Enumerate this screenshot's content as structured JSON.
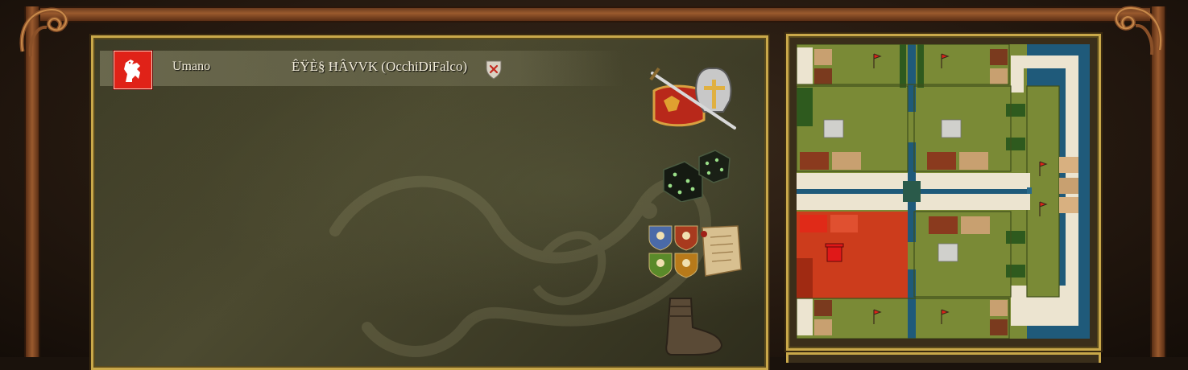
{
  "lobby": {
    "players": [
      {
        "type_label": "Umano",
        "name": "ÊŸÈ§ ĦÂVVK (OcchiDiFalco)",
        "color": "#e02218"
      }
    ]
  },
  "icons": {
    "player_crest": "lion-rampant-icon",
    "kick": "kick-shield-icon",
    "weapons": "sword-helmet-icon",
    "dice": "dice-icon",
    "teams": "team-shields-icon",
    "boot": "boot-icon"
  },
  "colors": {
    "panel_border": "#c9a84a",
    "player_red": "#e02218",
    "map_grass": "#7a8a36",
    "map_water": "#1f5a7a",
    "map_sand": "#ece4d0",
    "map_player_territory": "#cc3c1c"
  }
}
